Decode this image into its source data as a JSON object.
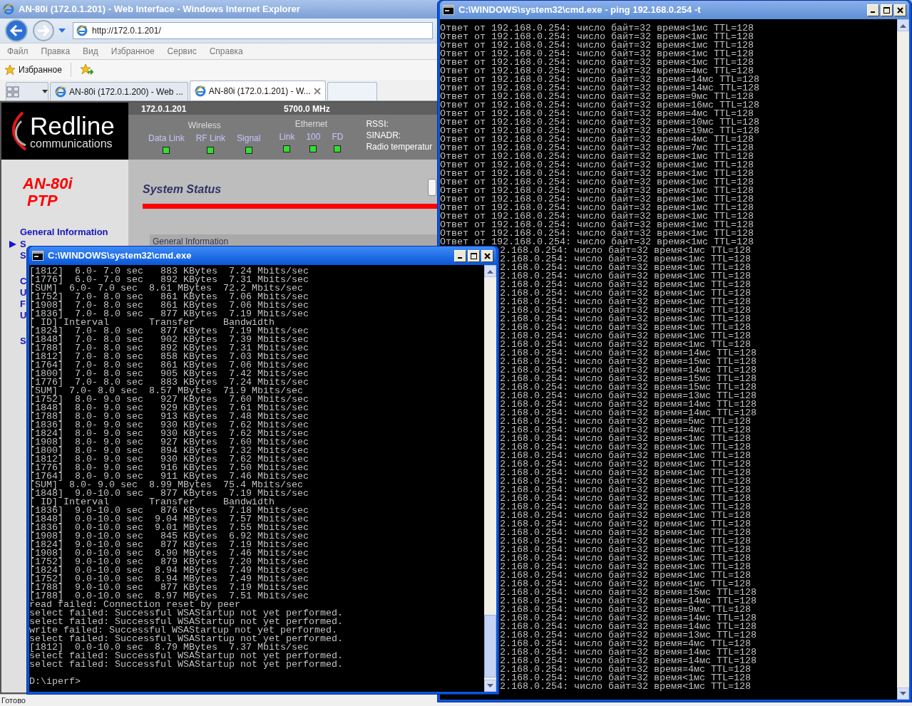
{
  "ie_window": {
    "title": "AN-80i (172.0.1.201) - Web Interface - Windows Internet Explorer",
    "address": "http://172.0.1.201/",
    "menu": [
      "Файл",
      "Правка",
      "Вид",
      "Избранное",
      "Сервис",
      "Справка"
    ],
    "favorites_label": "Избранное",
    "tabs": [
      {
        "label": "AN-80i (172.0.1.200) - Web ...",
        "selected": false
      },
      {
        "label": "AN-80i (172.0.1.201) - W...",
        "selected": true
      }
    ],
    "status": "Готово"
  },
  "device_page": {
    "logo_name": "Redline",
    "logo_tagline": "communications",
    "ip": "172.0.1.201",
    "frequency": "5700.0 MHz",
    "indicator_groups": [
      {
        "heading": "Wireless",
        "indicators": [
          {
            "label": "Data Link",
            "on": true
          },
          {
            "label": "RF Link",
            "on": true
          },
          {
            "label": "Signal",
            "on": true
          }
        ]
      },
      {
        "heading": "Ethernet",
        "indicators": [
          {
            "label": "Link",
            "on": true
          },
          {
            "label": "100",
            "on": true
          },
          {
            "label": "FD",
            "on": true
          }
        ]
      }
    ],
    "readouts": [
      "RSSI:",
      "SINADR:",
      "Radio temperatur"
    ],
    "model": "AN-80i",
    "mode": "PTP",
    "sidebar": {
      "link": "General Information",
      "groups": [
        [
          {
            "text": "S",
            "selected": true
          },
          {
            "text": "S",
            "selected": false
          }
        ],
        [
          {
            "text": "C",
            "selected": false
          },
          {
            "text": "U",
            "selected": false
          },
          {
            "text": "F",
            "selected": false
          },
          {
            "text": "U",
            "selected": false
          }
        ],
        [
          {
            "text": "S",
            "selected": false
          }
        ]
      ]
    },
    "page_title": "System Status",
    "panel_heading": "General Information"
  },
  "ping_window": {
    "title": "C:\\WINDOWS\\system32\\cmd.exe - ping 192.168.0.254 -t",
    "lines": [
      "Ответ от 192.168.0.254: число байт=32 время<1мс TTL=128",
      "Ответ от 192.168.0.254: число байт=32 время<1мс TTL=128",
      "Ответ от 192.168.0.254: число байт=32 время<1мс TTL=128",
      "Ответ от 192.168.0.254: число байт=32 время<1мс TTL=128",
      "Ответ от 192.168.0.254: число байт=32 время<1мс TTL=128",
      "Ответ от 192.168.0.254: число байт=32 время=4мс TTL=128",
      "Ответ от 192.168.0.254: число байт=32 время=14мс TTL=128",
      "Ответ от 192.168.0.254: число байт=32 время=14мс TTL=128",
      "Ответ от 192.168.0.254: число байт=32 время=9мс TTL=128",
      "Ответ от 192.168.0.254: число байт=32 время=16мс TTL=128",
      "Ответ от 192.168.0.254: число байт=32 время=4мс TTL=128",
      "Ответ от 192.168.0.254: число байт=32 время=10мс TTL=128",
      "Ответ от 192.168.0.254: число байт=32 время=19мс TTL=128",
      "Ответ от 192.168.0.254: число байт=32 время=4мс TTL=128",
      "Ответ от 192.168.0.254: число байт=32 время=7мс TTL=128",
      "Ответ от 192.168.0.254: число байт=32 время<1мс TTL=128",
      "Ответ от 192.168.0.254: число байт=32 время<1мс TTL=128",
      "Ответ от 192.168.0.254: число байт=32 время<1мс TTL=128",
      "Ответ от 192.168.0.254: число байт=32 время<1мс TTL=128",
      "Ответ от 192.168.0.254: число байт=32 время<1мс TTL=128",
      "Ответ от 192.168.0.254: число байт=32 время<1мс TTL=128",
      "Ответ от 192.168.0.254: число байт=32 время<1мс TTL=128",
      "Ответ от 192.168.0.254: число байт=32 время<1мс TTL=128",
      "Ответ от 192.168.0.254: число байт=32 время<1мс TTL=128",
      "Ответ от 192.168.0.254: число байт=32 время<1мс TTL=128",
      "Ответ от 192.168.0.254: число байт=32 время<1мс TTL=128"
    ],
    "partial_lines": [
      "2.168.0.254: число байт=32 время<1мс TTL=128",
      "2.168.0.254: число байт=32 время<1мс TTL=128",
      "2.168.0.254: число байт=32 время<1мс TTL=128",
      "2.168.0.254: число байт=32 время<1мс TTL=128",
      "2.168.0.254: число байт=32 время<1мс TTL=128",
      "2.168.0.254: число байт=32 время<1мс TTL=128",
      "2.168.0.254: число байт=32 время<1мс TTL=128",
      "2.168.0.254: число байт=32 время<1мс TTL=128",
      "2.168.0.254: число байт=32 время<1мс TTL=128",
      "2.168.0.254: число байт=32 время<1мс TTL=128",
      "2.168.0.254: число байт=32 время<1мс TTL=128",
      "2.168.0.254: число байт=32 время<1мс TTL=128",
      "2.168.0.254: число байт=32 время=14мс TTL=128",
      "2.168.0.254: число байт=32 время=15мс TTL=128",
      "2.168.0.254: число байт=32 время=14мс TTL=128",
      "2.168.0.254: число байт=32 время=15мс TTL=128",
      "2.168.0.254: число байт=32 время=15мс TTL=128",
      "2.168.0.254: число байт=32 время=13мс TTL=128",
      "2.168.0.254: число байт=32 время=14мс TTL=128",
      "2.168.0.254: число байт=32 время=14мс TTL=128",
      "2.168.0.254: число байт=32 время=5мс TTL=128",
      "2.168.0.254: число байт=32 время=4мс TTL=128",
      "2.168.0.254: число байт=32 время<1мс TTL=128",
      "2.168.0.254: число байт=32 время<1мс TTL=128",
      "2.168.0.254: число байт=32 время<1мс TTL=128",
      "2.168.0.254: число байт=32 время<1мс TTL=128",
      "2.168.0.254: число байт=32 время<1мс TTL=128",
      "2.168.0.254: число байт=32 время<1мс TTL=128",
      "2.168.0.254: число байт=32 время<1мс TTL=128",
      "2.168.0.254: число байт=32 время<1мс TTL=128",
      "2.168.0.254: число байт=32 время<1мс TTL=128",
      "2.168.0.254: число байт=32 время<1мс TTL=128",
      "2.168.0.254: число байт=32 время<1мс TTL=128",
      "2.168.0.254: число байт=32 время<1мс TTL=128",
      "2.168.0.254: число байт=32 время<1мс TTL=128",
      "2.168.0.254: число байт=32 время<1мс TTL=128",
      "2.168.0.254: число байт=32 время<1мс TTL=128",
      "2.168.0.254: число байт=32 время<1мс TTL=128",
      "2.168.0.254: число байт=32 время<1мс TTL=128",
      "2.168.0.254: число байт=32 время<1мс TTL=128",
      "2.168.0.254: число байт=32 время=15мс TTL=128",
      "2.168.0.254: число байт=32 время=14мс TTL=128",
      "2.168.0.254: число байт=32 время=9мс TTL=128",
      "2.168.0.254: число байт=32 время=14мс TTL=128",
      "2.168.0.254: число байт=32 время=14мс TTL=128",
      "2.168.0.254: число байт=32 время=13мс TTL=128",
      "2.168.0.254: число байт=32 время=4мс TTL=128",
      "2.168.0.254: число байт=32 время=14мс TTL=128",
      "2.168.0.254: число байт=32 время=14мс TTL=128",
      "2.168.0.254: число байт=32 время=4мс TTL=128",
      "2.168.0.254: число байт=32 время<1мс TTL=128",
      "2.168.0.254: число байт=32 время<1мс TTL=128"
    ]
  },
  "iperf_window": {
    "title": "C:\\WINDOWS\\system32\\cmd.exe",
    "lines": [
      "[1812]  6.0- 7.0 sec   883 KBytes  7.24 Mbits/sec",
      "[1776]  6.0- 7.0 sec   892 KBytes  7.31 Mbits/sec",
      "[SUM]  6.0- 7.0 sec  8.61 MBytes  72.2 Mbits/sec",
      "[1752]  7.0- 8.0 sec   861 KBytes  7.06 Mbits/sec",
      "[1908]  7.0- 8.0 sec   861 KBytes  7.06 Mbits/sec",
      "[1836]  7.0- 8.0 sec   877 KBytes  7.19 Mbits/sec",
      "[ ID] Interval       Transfer     Bandwidth",
      "[1824]  7.0- 8.0 sec   877 KBytes  7.19 Mbits/sec",
      "[1848]  7.0- 8.0 sec   902 KBytes  7.39 Mbits/sec",
      "[1788]  7.0- 8.0 sec   892 KBytes  7.31 Mbits/sec",
      "[1812]  7.0- 8.0 sec   858 KBytes  7.03 Mbits/sec",
      "[1764]  7.0- 8.0 sec   861 KBytes  7.06 Mbits/sec",
      "[1800]  7.0- 8.0 sec   905 KBytes  7.42 Mbits/sec",
      "[1776]  7.0- 8.0 sec   883 KBytes  7.24 Mbits/sec",
      "[SUM]  7.0- 8.0 sec  8.57 MBytes  71.9 Mbits/sec",
      "[1752]  8.0- 9.0 sec   927 KBytes  7.60 Mbits/sec",
      "[1848]  8.0- 9.0 sec   929 KBytes  7.61 Mbits/sec",
      "[1788]  8.0- 9.0 sec   913 KBytes  7.48 Mbits/sec",
      "[1836]  8.0- 9.0 sec   930 KBytes  7.62 Mbits/sec",
      "[1824]  8.0- 9.0 sec   930 KBytes  7.62 Mbits/sec",
      "[1908]  8.0- 9.0 sec   927 KBytes  7.60 Mbits/sec",
      "[1800]  8.0- 9.0 sec   894 KBytes  7.32 Mbits/sec",
      "[1812]  8.0- 9.0 sec   930 KBytes  7.62 Mbits/sec",
      "[1776]  8.0- 9.0 sec   916 KBytes  7.50 Mbits/sec",
      "[1764]  8.0- 9.0 sec   911 KBytes  7.46 Mbits/sec",
      "[SUM]  8.0- 9.0 sec  8.99 MBytes  75.4 Mbits/sec",
      "[1848]  9.0-10.0 sec   877 KBytes  7.19 Mbits/sec",
      "[ ID] Interval       Transfer     Bandwidth",
      "[1836]  9.0-10.0 sec   876 KBytes  7.18 Mbits/sec",
      "[1848]  0.0-10.0 sec  9.04 MBytes  7.57 Mbits/sec",
      "[1836]  0.0-10.0 sec  9.01 MBytes  7.55 Mbits/sec",
      "[1908]  9.0-10.0 sec   845 KBytes  6.92 Mbits/sec",
      "[1824]  9.0-10.0 sec   877 KBytes  7.19 Mbits/sec",
      "[1908]  0.0-10.0 sec  8.90 MBytes  7.46 Mbits/sec",
      "[1752]  9.0-10.0 sec   879 KBytes  7.20 Mbits/sec",
      "[1824]  0.0-10.0 sec  8.94 MBytes  7.49 Mbits/sec",
      "[1752]  0.0-10.0 sec  8.94 MBytes  7.49 Mbits/sec",
      "[1788]  9.0-10.0 sec   877 KBytes  7.19 Mbits/sec",
      "[1788]  0.0-10.0 sec  8.97 MBytes  7.51 Mbits/sec",
      "read failed: Connection reset by peer",
      "select failed: Successful WSAStartup not yet performed.",
      "select failed: Successful WSAStartup not yet performed.",
      "write failed: Successful WSAStartup not yet performed.",
      "select failed: Successful WSAStartup not yet performed.",
      "[1812]  0.0-10.0 sec  8.79 MBytes  7.37 Mbits/sec",
      "select failed: Successful WSAStartup not yet performed.",
      "select failed: Successful WSAStartup not yet performed."
    ],
    "prompt": "D:\\iperf>"
  }
}
